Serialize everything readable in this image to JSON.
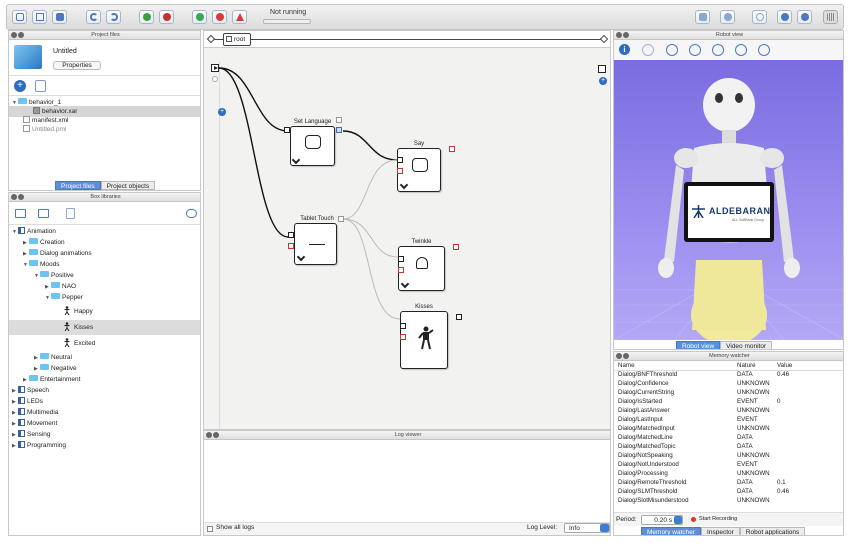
{
  "toolbar": {
    "status": "Not running"
  },
  "project_files": {
    "title": "Project files",
    "project_name": "Untitled",
    "properties_button": "Properties",
    "files": [
      "behavior_1",
      "behavior.xar",
      "manifest.xml",
      "Untitled.pml"
    ],
    "tabs": [
      "Project files",
      "Project objects"
    ]
  },
  "box_libraries": {
    "title": "Box libraries",
    "tree": [
      "Animation",
      "Creation",
      "Dialog animations",
      "Moods",
      "Positive",
      "NAO",
      "Pepper",
      "Happy",
      "Kisses",
      "Excited",
      "Neutral",
      "Negative",
      "Entertainment",
      "Speech",
      "LEDs",
      "Multimedia",
      "Movement",
      "Sensing",
      "Programming"
    ]
  },
  "flow": {
    "breadcrumb": "root",
    "boxes": {
      "set_language": "Set Language",
      "say": "Say",
      "tablet_touch": "Tablet Touch",
      "twinkle": "Twinkle",
      "kisses": "Kisses"
    }
  },
  "log_viewer": {
    "title": "Log viewer",
    "show_all_logs": "Show all logs",
    "log_level_label": "Log Level:",
    "log_level_value": "Info"
  },
  "robot_view": {
    "title": "Robot view",
    "tablet_brand": "ALDEBARAN",
    "tablet_sub": "ALL SoftBank Group",
    "tabs": [
      "Robot view",
      "Video monitor"
    ]
  },
  "memory_watcher": {
    "title": "Memory watcher",
    "headers": [
      "Name",
      "Nature",
      "Value"
    ],
    "rows": [
      [
        "Dialog/BNFThreshold",
        "DATA",
        "0.46"
      ],
      [
        "Dialog/Confidence",
        "UNKNOWN",
        ""
      ],
      [
        "Dialog/CurrentString",
        "UNKNOWN",
        ""
      ],
      [
        "Dialog/IsStarted",
        "EVENT",
        "0"
      ],
      [
        "Dialog/LastAnswer",
        "UNKNOWN",
        ""
      ],
      [
        "Dialog/LastInput",
        "EVENT",
        ""
      ],
      [
        "Dialog/MatchedInput",
        "UNKNOWN",
        ""
      ],
      [
        "Dialog/MatchedLine",
        "DATA",
        ""
      ],
      [
        "Dialog/MatchedTopic",
        "DATA",
        ""
      ],
      [
        "Dialog/NotSpeaking",
        "UNKNOWN",
        ""
      ],
      [
        "Dialog/NotUnderstood",
        "EVENT",
        ""
      ],
      [
        "Dialog/Processing",
        "UNKNOWN",
        ""
      ],
      [
        "Dialog/RemoteThreshold",
        "DATA",
        "0.1"
      ],
      [
        "Dialog/SLMThreshold",
        "DATA",
        "0.46"
      ],
      [
        "Dialog/SlotMisunderstood",
        "UNKNOWN",
        ""
      ]
    ],
    "period_label": "Period:",
    "period_value": "0.20 s",
    "recording_label": "Start Recording",
    "tabs": [
      "Memory watcher",
      "Inspector",
      "Robot applications"
    ]
  }
}
